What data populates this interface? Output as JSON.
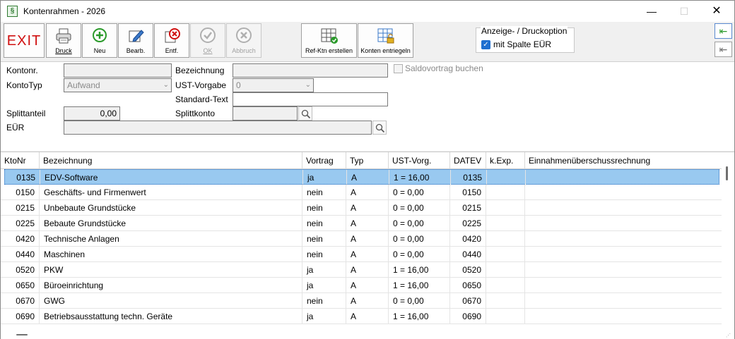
{
  "window": {
    "title": "Kontenrahmen - 2026",
    "app_icon_glyph": "§"
  },
  "toolbar": {
    "exit_label": "EXIT",
    "buttons": [
      {
        "label": "Druck",
        "icon": "printer-icon"
      },
      {
        "label": "Neu",
        "icon": "plus-icon"
      },
      {
        "label": "Bearb.",
        "icon": "pencil-icon"
      },
      {
        "label": "Entf.",
        "icon": "delete-icon"
      },
      {
        "label": "OK",
        "icon": "check-icon"
      },
      {
        "label": "Abbruch",
        "icon": "cancel-icon"
      },
      {
        "label": "Ref-Ktn erstellen",
        "icon": "grid-check-icon"
      },
      {
        "label": "Konten entriegeln",
        "icon": "grid-lock-icon"
      }
    ],
    "options": {
      "legend": "Anzeige- / Druckoption",
      "checkbox_label": "mit Spalte EÜR"
    }
  },
  "form": {
    "kontonr_label": "Kontonr.",
    "kontonr_value": "",
    "kontotyp_label": "KontoTyp",
    "kontotyp_value": "Aufwand",
    "bezeichnung_label": "Bezeichnung",
    "bezeichnung_value": "",
    "ust_label": "UST-Vorgabe",
    "ust_value": "0",
    "standardtext_label": "Standard-Text",
    "standardtext_value": "",
    "splittanteil_label": "Splittanteil",
    "splittanteil_value": "0,00",
    "splittkonto_label": "Splittkonto",
    "splittkonto_value": "",
    "eur_label": "EÜR",
    "eur_value": "",
    "saldovortrag_label": "Saldovortrag buchen"
  },
  "table": {
    "columns": [
      "KtoNr",
      "Bezeichnung",
      "Vortrag",
      "Typ",
      "UST-Vorg.",
      "DATEV",
      "k.Exp.",
      "Einnahmenüberschussrechnung"
    ],
    "rows": [
      [
        "0135",
        "EDV-Software",
        "ja",
        "A",
        "1 = 16,00",
        "0135",
        "",
        ""
      ],
      [
        "0150",
        "Geschäfts- und Firmenwert",
        "nein",
        "A",
        "0 = 0,00",
        "0150",
        "",
        ""
      ],
      [
        "0215",
        "Unbebaute Grundstücke",
        "nein",
        "A",
        "0 = 0,00",
        "0215",
        "",
        ""
      ],
      [
        "0225",
        "Bebaute Grundstücke",
        "nein",
        "A",
        "0 = 0,00",
        "0225",
        "",
        ""
      ],
      [
        "0420",
        "Technische Anlagen",
        "nein",
        "A",
        "0 = 0,00",
        "0420",
        "",
        ""
      ],
      [
        "0440",
        "Maschinen",
        "nein",
        "A",
        "0 = 0,00",
        "0440",
        "",
        ""
      ],
      [
        "0520",
        "PKW",
        "ja",
        "A",
        "1 = 16,00",
        "0520",
        "",
        ""
      ],
      [
        "0650",
        "Büroeinrichtung",
        "ja",
        "A",
        "1 = 16,00",
        "0650",
        "",
        ""
      ],
      [
        "0670",
        "GWG",
        "nein",
        "A",
        "0 = 0,00",
        "0670",
        "",
        ""
      ],
      [
        "0690",
        "Betriebsausstattung techn. Geräte",
        "ja",
        "A",
        "1 = 16,00",
        "0690",
        "",
        ""
      ]
    ]
  }
}
